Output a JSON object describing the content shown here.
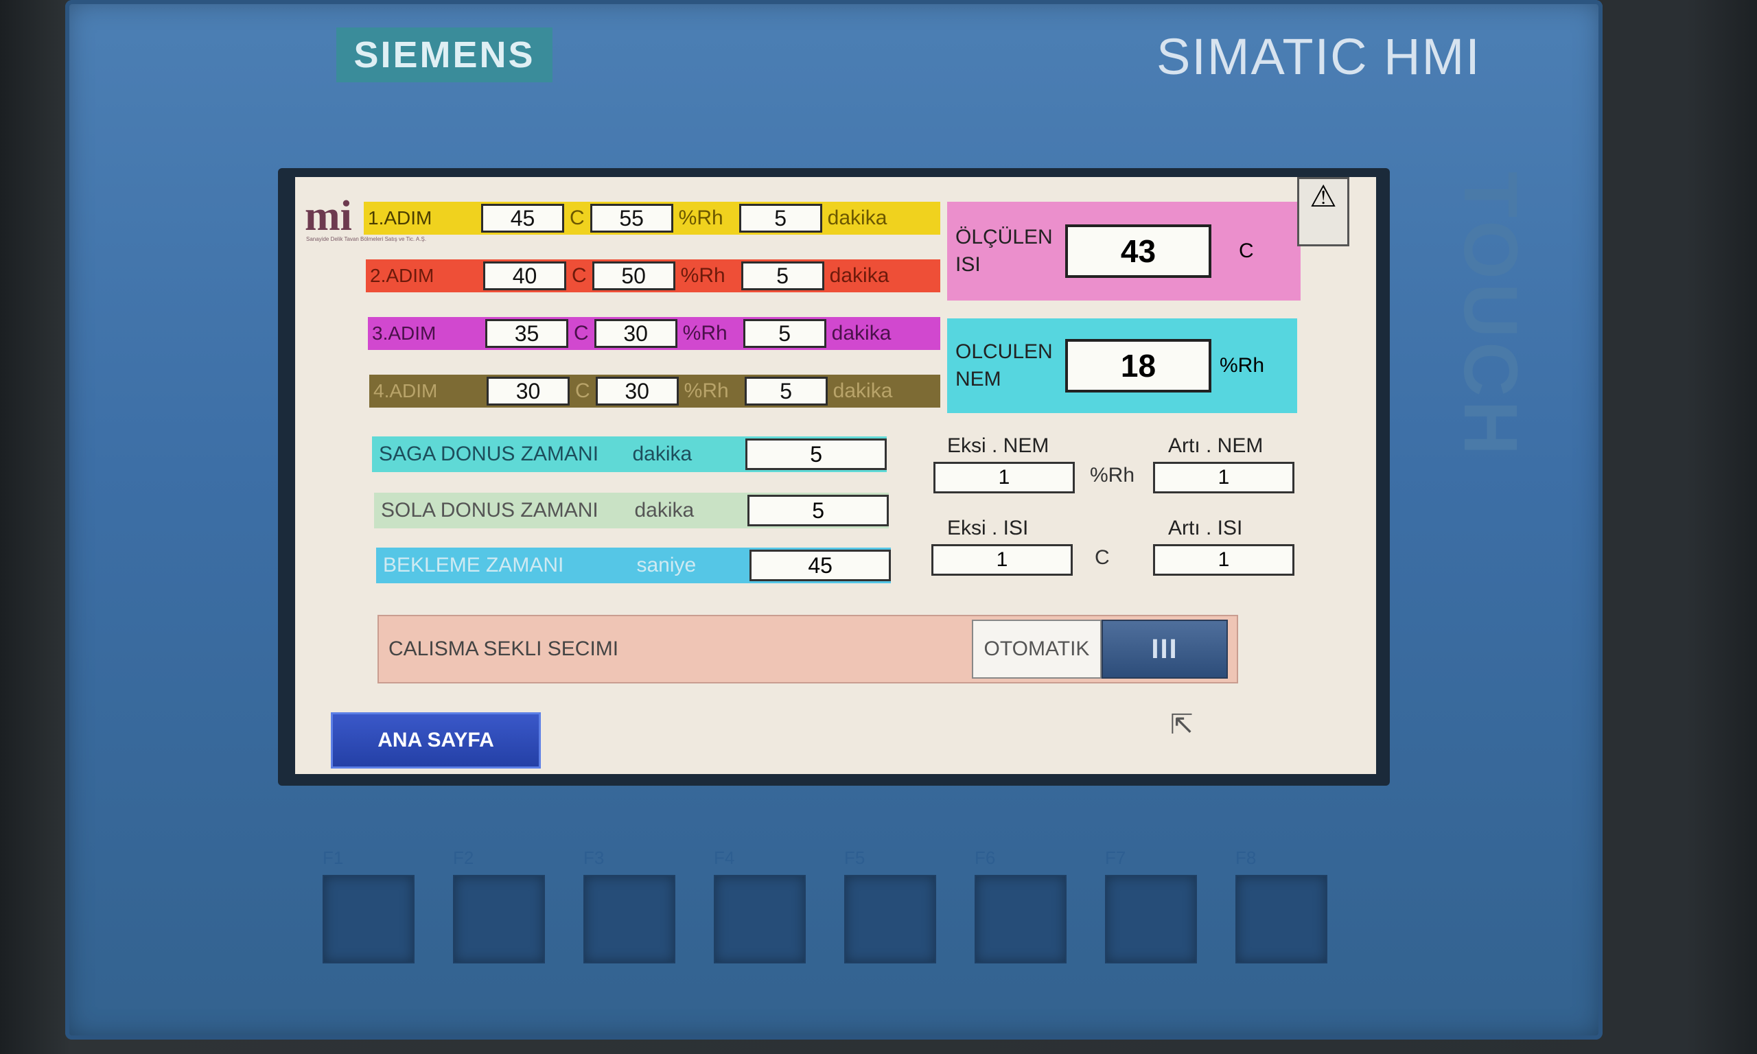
{
  "device": {
    "brand": "SIEMENS",
    "model": "SIMATIC HMI",
    "side_label": "TOUCH"
  },
  "logo": {
    "text": "mi",
    "subtitle": "Sanayide Delik Tavan Bölmeleri Satış ve Tic. A.Ş."
  },
  "colors": {
    "step1": "#f0d21e",
    "step2": "#ee4f37",
    "step3": "#d148cf",
    "step4": "#7d6b34",
    "isi_panel": "#eb8fcc",
    "nem_panel": "#56d6df",
    "saga": "#5fd9d6",
    "sola": "#c9e2c5",
    "bekleme": "#55c6e6"
  },
  "steps": [
    {
      "label": "1.ADIM",
      "temp": "45",
      "temp_unit": "C",
      "rh": "55",
      "rh_unit": "%Rh",
      "time": "5",
      "time_unit": "dakika"
    },
    {
      "label": "2.ADIM",
      "temp": "40",
      "temp_unit": "C",
      "rh": "50",
      "rh_unit": "%Rh",
      "time": "5",
      "time_unit": "dakika"
    },
    {
      "label": "3.ADIM",
      "temp": "35",
      "temp_unit": "C",
      "rh": "30",
      "rh_unit": "%Rh",
      "time": "5",
      "time_unit": "dakika"
    },
    {
      "label": "4.ADIM",
      "temp": "30",
      "temp_unit": "C",
      "rh": "30",
      "rh_unit": "%Rh",
      "time": "5",
      "time_unit": "dakika"
    }
  ],
  "measured_temp": {
    "label_line1": "ÖLÇÜLEN",
    "label_line2": "ISI",
    "value": "43",
    "unit": "C"
  },
  "measured_humidity": {
    "label_line1": "OLCULEN",
    "label_line2": "NEM",
    "value": "18",
    "unit": "%Rh"
  },
  "alarm": {
    "icon": "warning-icon",
    "glyph": "⚠"
  },
  "timers": [
    {
      "label": "SAGA DONUS ZAMANI",
      "unit": "dakika",
      "value": "5"
    },
    {
      "label": "SOLA DONUS ZAMANI",
      "unit": "dakika",
      "value": "5"
    },
    {
      "label": "BEKLEME ZAMANI",
      "unit": "saniye",
      "value": "45"
    }
  ],
  "adjust": {
    "eksi_nem_label": "Eksi . NEM",
    "eksi_nem": "1",
    "arti_nem_label": "Artı . NEM",
    "arti_nem": "1",
    "nem_unit": "%Rh",
    "eksi_isi_label": "Eksi . ISI",
    "eksi_isi": "1",
    "arti_isi_label": "Artı . ISI",
    "arti_isi": "1",
    "isi_unit": "C"
  },
  "mode": {
    "label": "CALISMA SEKLI SECIMI",
    "value": "OTOMATIK",
    "switch_glyph": "III"
  },
  "home_button": "ANA SAYFA",
  "fkeys": [
    "F1",
    "F2",
    "F3",
    "F4",
    "F5",
    "F6",
    "F7",
    "F8"
  ]
}
